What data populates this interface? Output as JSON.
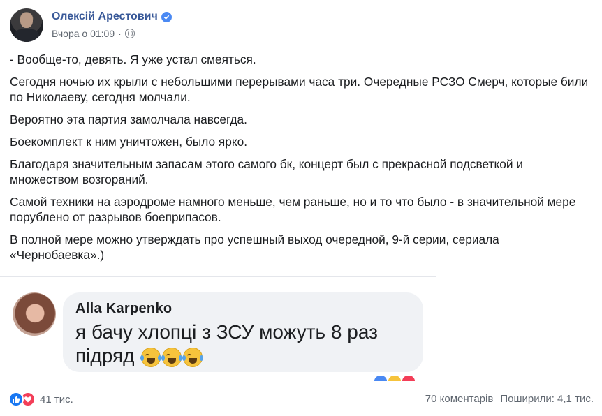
{
  "post": {
    "author": "Олексій Арестович",
    "timestamp": "Вчора о 01:09",
    "paragraphs": [
      "- Вообще-то, девять. Я уже устал смеяться.",
      "Сегодня ночью их крыли с небольшими перерывами часа три. Очередные РСЗО Смерч, которые били по Николаеву, сегодня молчали.",
      "Вероятно эта партия замолчала навсегда.",
      "Боекомплект к ним уничтожен, было ярко.",
      "Благодаря значительным запасам этого самого бк, концерт был с прекрасной подсветкой и множеством возгораний.",
      "Самой техники на аэродроме намного меньше, чем раньше, но и то что было - в значительной мере порублено от разрывов боеприпасов.",
      "В полной мере можно утверждать про успешный выход очередной, 9-й серии, сериала «Чернобаевка».)"
    ]
  },
  "embedded_comment": {
    "name": "Alla Karpenko",
    "text": "я бачу хлопці з ЗСУ можуть 8 раз підряд"
  },
  "footer": {
    "reactions_count": "41 тис.",
    "comments": "70 коментарів",
    "shares": "Поширили: 4,1 тис."
  },
  "colors": {
    "author_link": "#385898",
    "like_blue": "#1877f2",
    "love_red": "#f33e58",
    "meta_gray": "#606770"
  },
  "icons": [
    "verified-badge-icon",
    "globe-icon",
    "like-reaction-icon",
    "love-reaction-icon",
    "tears-of-joy-emoji"
  ]
}
